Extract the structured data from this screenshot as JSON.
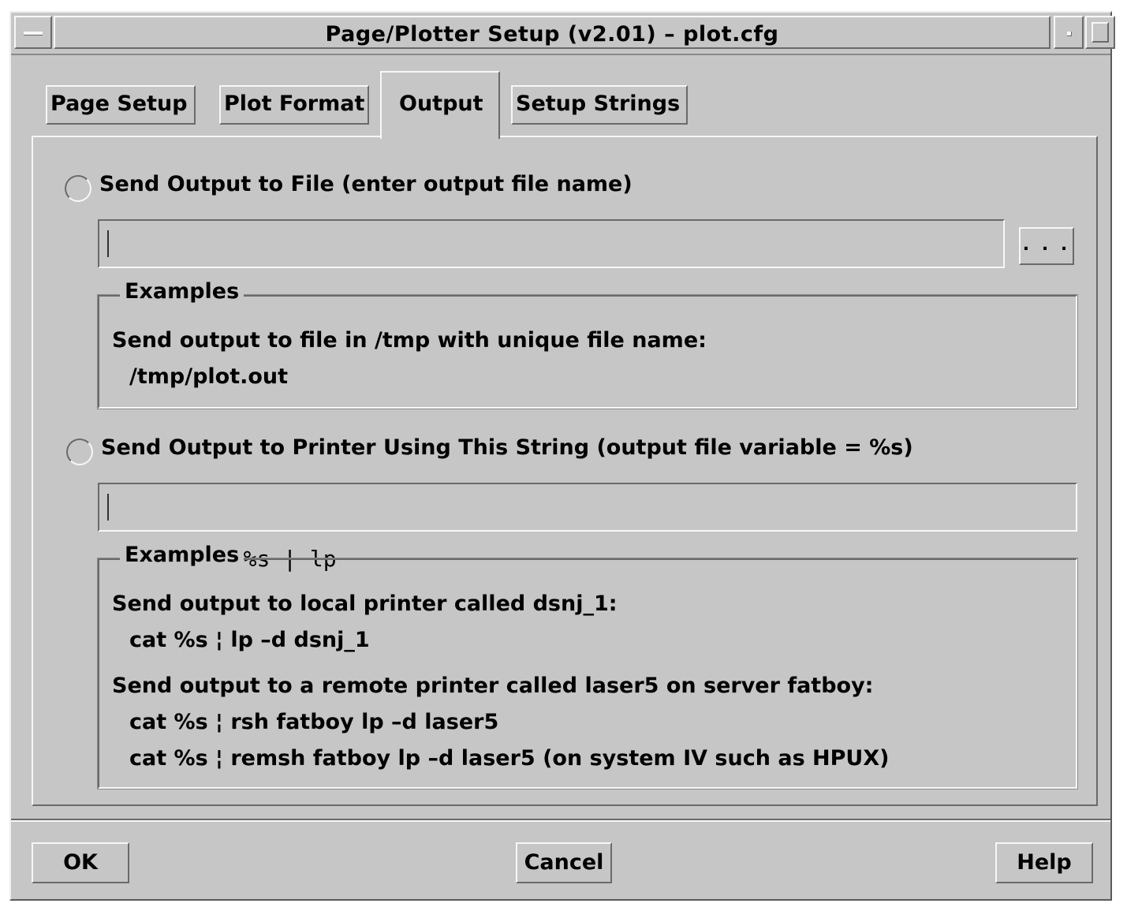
{
  "window": {
    "title": "Page/Plotter Setup  (v2.01) – plot.cfg",
    "menu_icon": "window-menu-icon",
    "minimize_icon": "minimize-icon",
    "maximize_icon": "maximize-icon"
  },
  "tabs": [
    {
      "label": "Page Setup",
      "active": false
    },
    {
      "label": "Plot Format",
      "active": false
    },
    {
      "label": "Output",
      "active": true
    },
    {
      "label": "Setup Strings",
      "active": false
    }
  ],
  "file_option": {
    "label": "Send Output to File (enter output file name)",
    "selected": false,
    "value": "",
    "browse_label": ". . ."
  },
  "file_examples": {
    "title": "Examples",
    "lines": [
      "Send output to file in /tmp with unique file name:",
      "/tmp/plot.out"
    ]
  },
  "printer_option": {
    "label": "Send Output to Printer Using This String (output file variable = %s)",
    "selected": false,
    "value": "cat %s | lp"
  },
  "printer_examples": {
    "title": "Examples",
    "lines": [
      "Send output to local printer called dsnj_1:",
      "cat %s ¦ lp –d dsnj_1",
      "Send output to a remote printer called laser5 on server fatboy:",
      "cat %s ¦ rsh fatboy lp –d laser5",
      "cat %s ¦ remsh fatboy lp –d laser5  (on system IV such as HPUX)"
    ]
  },
  "buttons": {
    "ok": "OK",
    "cancel": "Cancel",
    "help": "Help"
  }
}
